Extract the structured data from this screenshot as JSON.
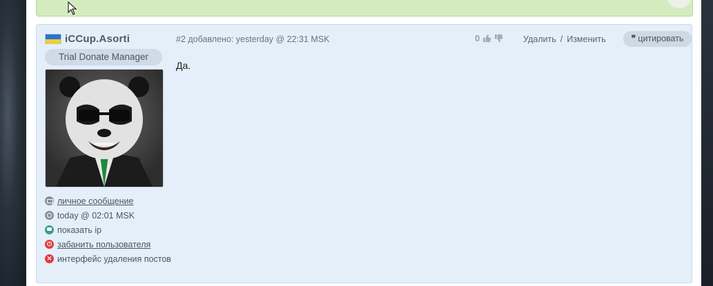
{
  "post": {
    "author_name": "iCCup.Asorti",
    "role": "Trial Donate Manager",
    "meta": "#2 добавлено: yesterday @ 22:31 MSK",
    "rating": "0",
    "actions": {
      "delete": "Удалить",
      "separator": "/",
      "edit": "Изменить"
    },
    "quote_label": "цитировать",
    "quote_glyph": "❞",
    "body": "Да.",
    "side_links": [
      {
        "icon": "mail-icon",
        "label": "личное сообщение"
      },
      {
        "icon": "clock-icon",
        "label": "today @ 02:01 MSK"
      },
      {
        "icon": "monitor-icon",
        "label": "показать ip"
      },
      {
        "icon": "power-icon",
        "label": "забанить пользователя"
      },
      {
        "icon": "delete-icon",
        "label": "интерфейс удаления постов"
      }
    ]
  },
  "colors": {
    "post_bg": "#e4eff9",
    "top_bar": "#d4ebc0",
    "flag_blue": "#2a72d6",
    "flag_yellow": "#f0cf2a",
    "danger": "#e23b3b"
  }
}
